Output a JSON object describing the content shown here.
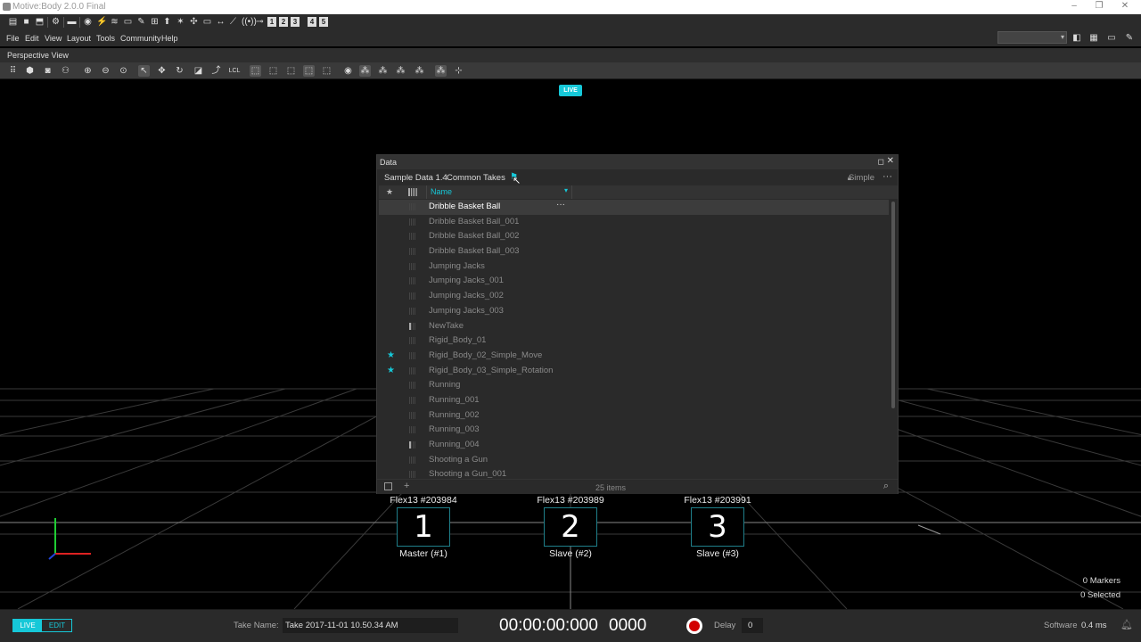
{
  "window": {
    "title": "Motive:Body 2.0.0 Final"
  },
  "toolbar": {
    "numbered_buttons": [
      "1",
      "2",
      "3",
      "4",
      "5"
    ]
  },
  "menu": {
    "items": [
      "File",
      "Edit",
      "View",
      "Layout",
      "Tools",
      "Community",
      "Help"
    ],
    "layout_select_value": ""
  },
  "perspective": {
    "title": "Perspective View",
    "live_badge": "LIVE",
    "lcl_label": "LCL"
  },
  "data_panel": {
    "title": "Data",
    "crumbs": [
      "Sample Data 1.4",
      "Common Takes"
    ],
    "mode": "Simple",
    "column_name": "Name",
    "rows": [
      {
        "name": "Dribble Basket Ball",
        "starred": false,
        "selected": true,
        "marked": false
      },
      {
        "name": "Dribble Basket Ball_001",
        "starred": false,
        "selected": false,
        "marked": false
      },
      {
        "name": "Dribble Basket Ball_002",
        "starred": false,
        "selected": false,
        "marked": false
      },
      {
        "name": "Dribble Basket Ball_003",
        "starred": false,
        "selected": false,
        "marked": false
      },
      {
        "name": "Jumping Jacks",
        "starred": false,
        "selected": false,
        "marked": false
      },
      {
        "name": "Jumping Jacks_001",
        "starred": false,
        "selected": false,
        "marked": false
      },
      {
        "name": "Jumping Jacks_002",
        "starred": false,
        "selected": false,
        "marked": false
      },
      {
        "name": "Jumping Jacks_003",
        "starred": false,
        "selected": false,
        "marked": false
      },
      {
        "name": "NewTake",
        "starred": false,
        "selected": false,
        "marked": true
      },
      {
        "name": "Rigid_Body_01",
        "starred": false,
        "selected": false,
        "marked": false
      },
      {
        "name": "Rigid_Body_02_Simple_Move",
        "starred": true,
        "selected": false,
        "marked": false
      },
      {
        "name": "Rigid_Body_03_Simple_Rotation",
        "starred": true,
        "selected": false,
        "marked": false
      },
      {
        "name": "Running",
        "starred": false,
        "selected": false,
        "marked": false
      },
      {
        "name": "Running_001",
        "starred": false,
        "selected": false,
        "marked": false
      },
      {
        "name": "Running_002",
        "starred": false,
        "selected": false,
        "marked": false
      },
      {
        "name": "Running_003",
        "starred": false,
        "selected": false,
        "marked": false
      },
      {
        "name": "Running_004",
        "starred": false,
        "selected": false,
        "marked": true
      },
      {
        "name": "Shooting a Gun",
        "starred": false,
        "selected": false,
        "marked": false
      },
      {
        "name": "Shooting a Gun_001",
        "starred": false,
        "selected": false,
        "marked": false
      }
    ],
    "item_count": "25 items"
  },
  "cameras": [
    {
      "name": "Flex13 #203984",
      "number": "1",
      "role": "Master (#1)"
    },
    {
      "name": "Flex13 #203989",
      "number": "2",
      "role": "Slave (#2)"
    },
    {
      "name": "Flex13 #203991",
      "number": "3",
      "role": "Slave (#3)"
    }
  ],
  "viewport_info": {
    "markers": "0 Markers",
    "selected": "0 Selected"
  },
  "bottom": {
    "live_label": "LIVE",
    "edit_label": "EDIT",
    "take_name_label": "Take Name:",
    "take_name_value": "Take 2017-11-01 10.50.34 AM",
    "timecode": "00:00:00:000",
    "frame": "0000",
    "delay_label": "Delay",
    "delay_value": "0",
    "software_label": "Software",
    "software_value": "0.4 ms"
  },
  "colors": {
    "accent": "#16c8d8",
    "record": "#d20000",
    "panel": "#2a2a2a"
  },
  "icons": [
    "motive-app-icon",
    "star-icon",
    "filter-icon",
    "lock-icon",
    "more-icon",
    "search-icon",
    "record-icon",
    "bell-icon"
  ]
}
